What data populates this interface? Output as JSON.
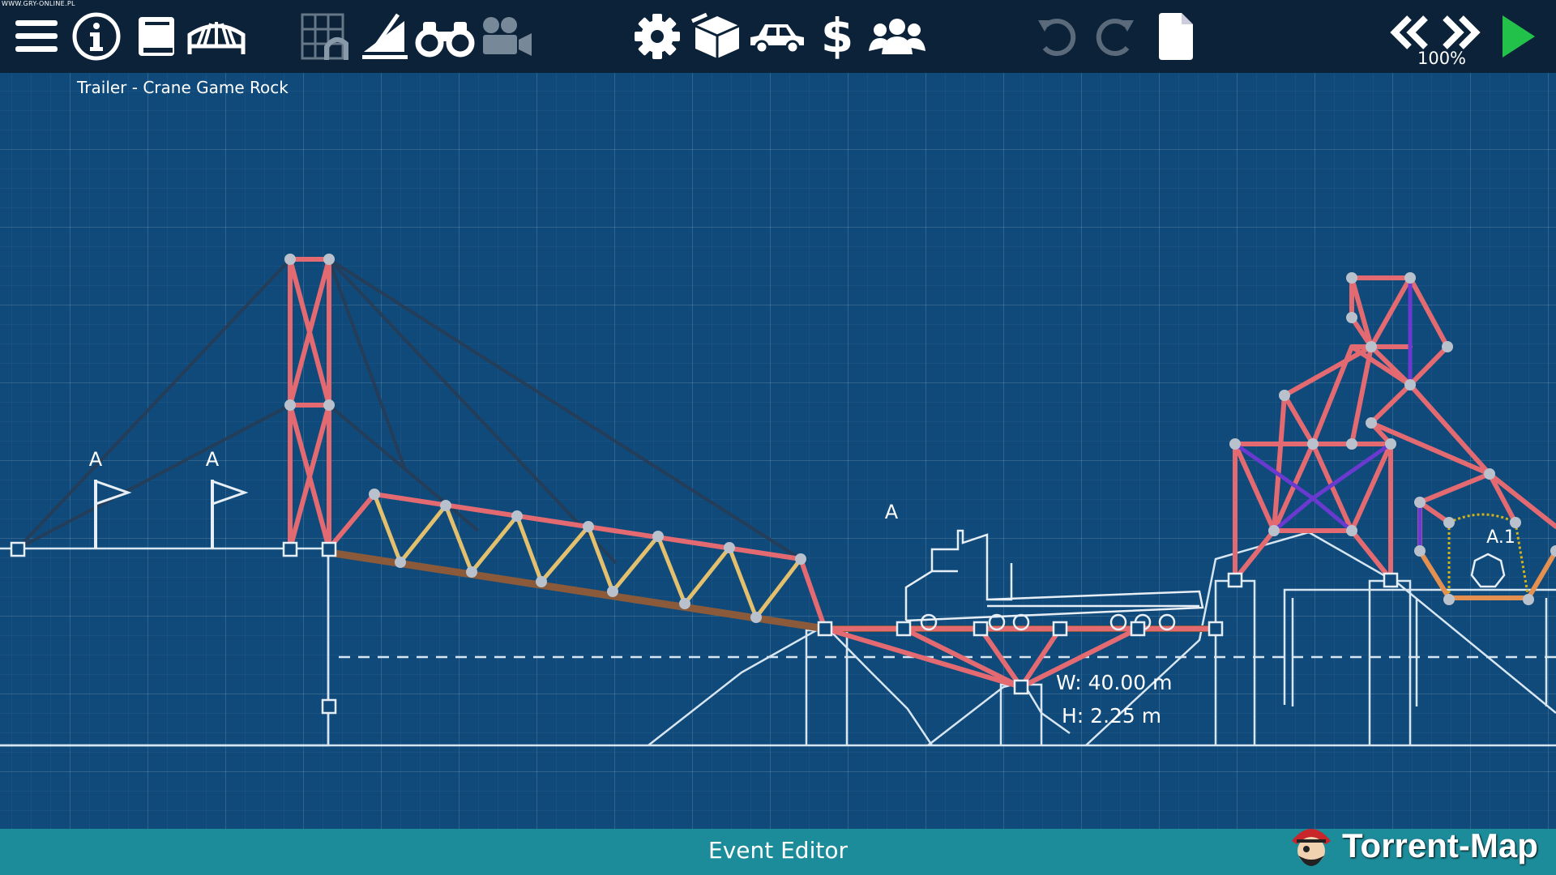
{
  "app": {
    "watermark_top": "WWW.GRY-ONLINE.PL",
    "level_name": "Trailer - Crane Game Rock",
    "speed": "100%",
    "bottom_bar_label": "Event Editor",
    "watermark_brand": "Torrent-Map"
  },
  "toolbar": {
    "left": [
      {
        "name": "menu-icon"
      },
      {
        "name": "info-icon"
      },
      {
        "name": "book-icon"
      },
      {
        "name": "bridge-icon"
      }
    ],
    "tools": [
      {
        "name": "grid-arch-icon",
        "dimmed": true
      },
      {
        "name": "ramp-icon"
      },
      {
        "name": "binoculars-icon"
      },
      {
        "name": "camera-icon",
        "dimmed": true
      }
    ],
    "center": [
      {
        "name": "gear-icon"
      },
      {
        "name": "box-icon"
      },
      {
        "name": "car-icon"
      },
      {
        "name": "dollar-icon"
      },
      {
        "name": "users-icon"
      }
    ],
    "history": [
      {
        "name": "undo-icon",
        "dimmed": true
      },
      {
        "name": "redo-icon",
        "dimmed": true
      },
      {
        "name": "page-icon"
      }
    ],
    "playback": [
      {
        "name": "rewind-icon"
      },
      {
        "name": "fast-forward-icon"
      },
      {
        "name": "play-icon"
      }
    ]
  },
  "scene": {
    "anchor_labels": [
      "A",
      "A",
      "A",
      "A.1"
    ],
    "dimension_width": "W: 40.00 m",
    "dimension_height": "H: 2.25 m"
  },
  "colors": {
    "toolbar_bg": "#0b2238",
    "workspace_bg": "#0f4a7a",
    "beam_steel": "#e46a72",
    "beam_wood": "#e3c06d",
    "road": "#8a5a3a",
    "cable": "#3a3a4a",
    "rope_purple": "#6a3ad0",
    "spring": "#d4b21a",
    "bottom_bar": "#1d8c9a",
    "play": "#22c24a"
  }
}
